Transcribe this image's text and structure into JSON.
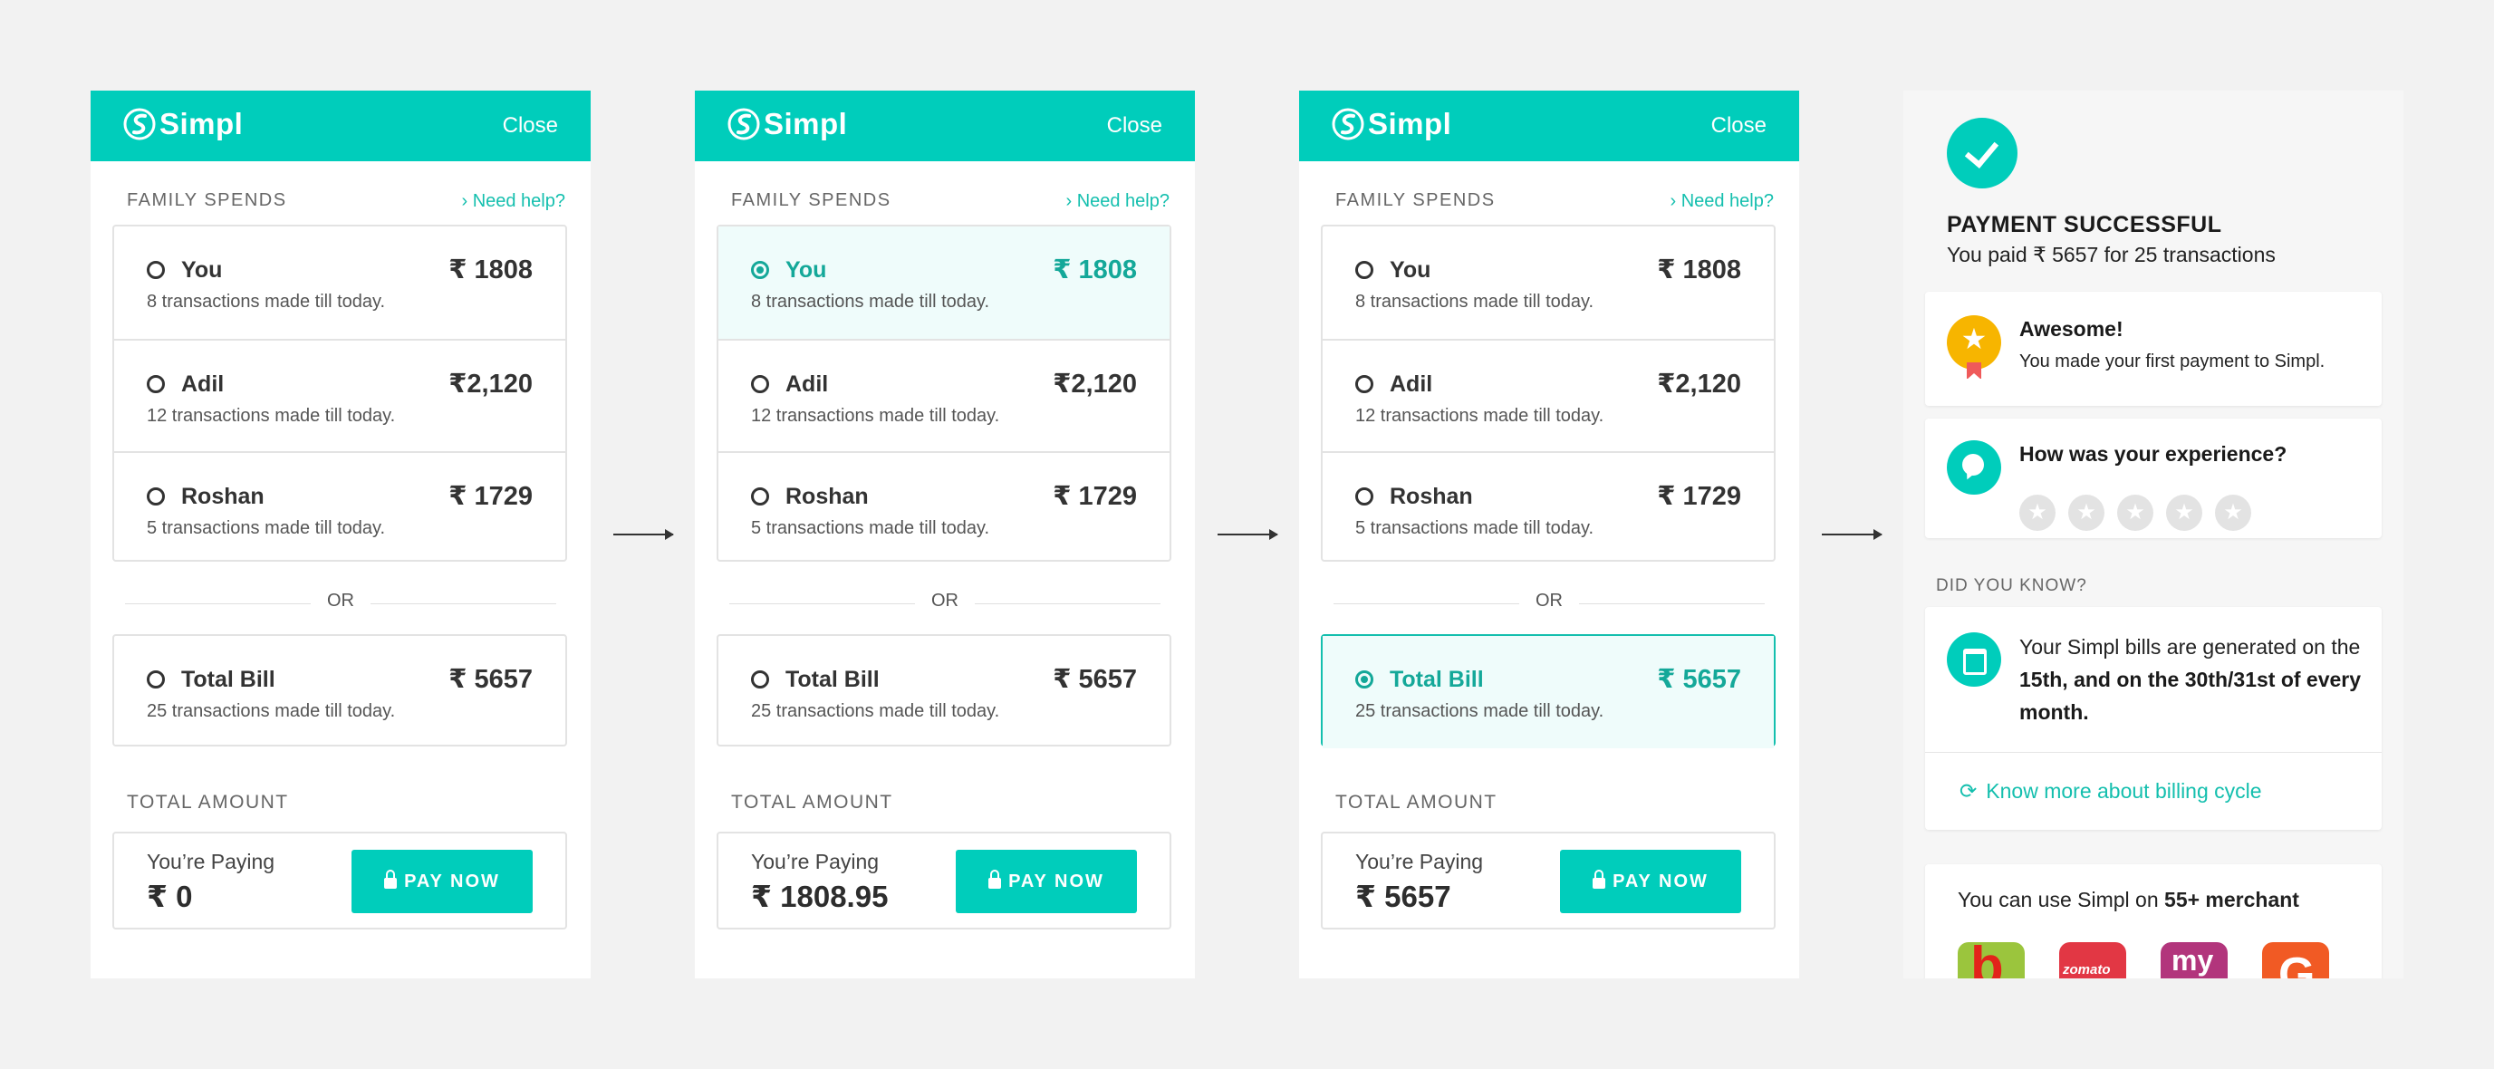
{
  "brand": {
    "name": "Simpl",
    "accent": "#00cdbb",
    "accent_dark": "#14a899"
  },
  "header": {
    "close_label": "Close"
  },
  "section": {
    "label": "FAMILY SPENDS",
    "help": "Need help?"
  },
  "members": [
    {
      "name": "You",
      "amount": "₹ 1808",
      "sub": "8 transactions made till today."
    },
    {
      "name": "Adil",
      "amount": "₹2,120",
      "sub": "12 transactions made till today."
    },
    {
      "name": "Roshan",
      "amount": "₹ 1729",
      "sub": "5 transactions made till today."
    }
  ],
  "or_label": "OR",
  "total_bill": {
    "name": "Total Bill",
    "amount": "₹ 5657",
    "sub": "25 transactions made till today."
  },
  "total": {
    "label": "TOTAL AMOUNT",
    "paying_label": "You’re Paying",
    "pay_button": "PAY NOW"
  },
  "screens": [
    {
      "paying_amount": "₹ 0",
      "selected": "none"
    },
    {
      "paying_amount": "₹ 1808.95",
      "selected": "You"
    },
    {
      "paying_amount": "₹ 5657",
      "selected": "Total Bill"
    }
  ],
  "success": {
    "title": "PAYMENT SUCCESSFUL",
    "subtitle": "You paid ₹ 5657 for 25 transactions",
    "award_title": "Awesome!",
    "award_text": "You made your first payment to Simpl.",
    "experience_title": "How was your experience?",
    "rating_max": 5,
    "rating_value": 0,
    "did_you_know": "DID YOU KNOW?",
    "bill_text_1": "Your Simpl bills are generated on the ",
    "bill_text_bold": "15th, and on the 30th/31st of every month.",
    "know_more": "Know more about billing cycle",
    "merchant_text": "You can use Simpl on ",
    "merchant_bold": "55+ merchant",
    "merchant_logos": [
      "bigbasket-logo",
      "zomato-logo",
      "bookmyshow-logo",
      "grofers-logo"
    ]
  }
}
